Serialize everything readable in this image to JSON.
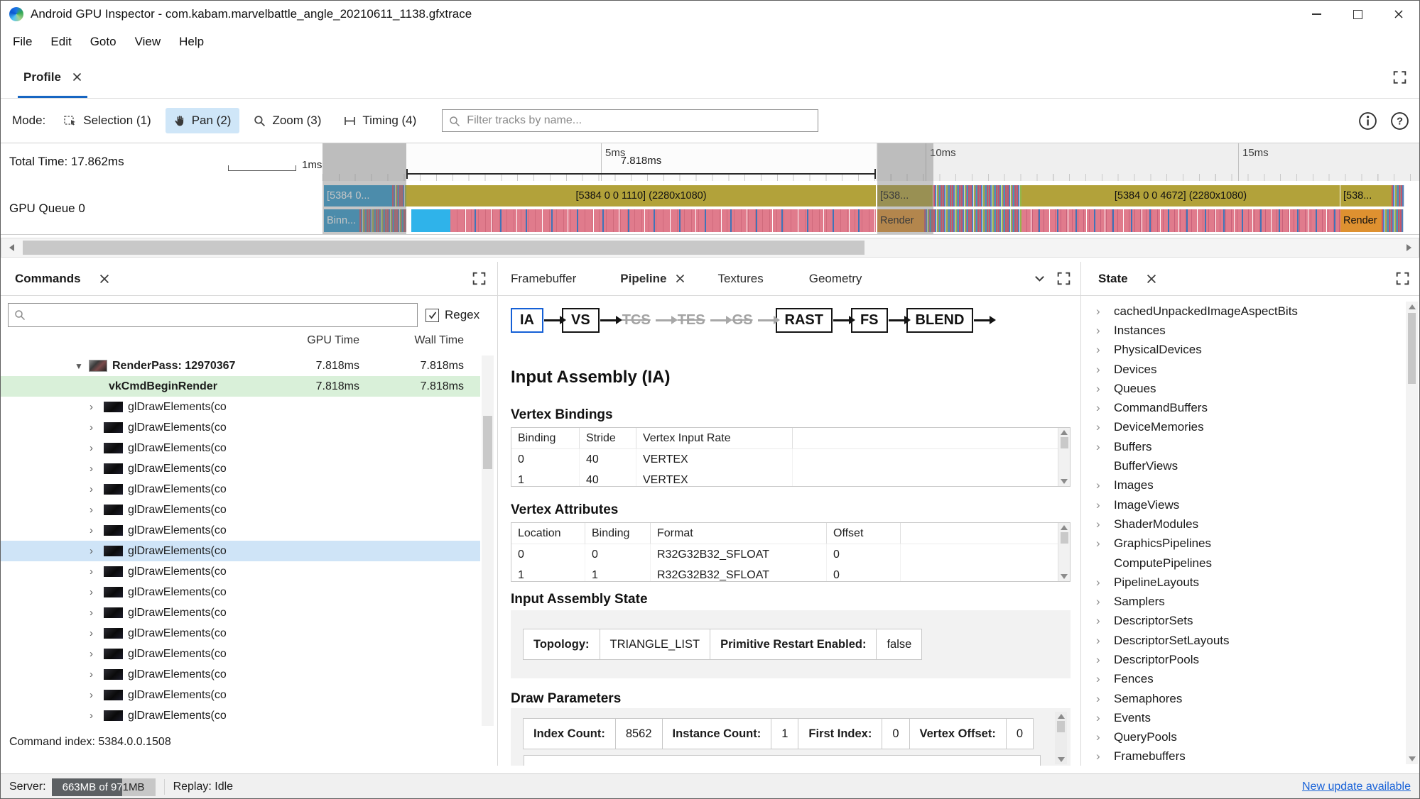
{
  "window": {
    "title": "Android GPU Inspector - com.kabam.marvelbattle_angle_20210611_1138.gfxtrace"
  },
  "menu": {
    "items": [
      {
        "label": "File"
      },
      {
        "label": "Edit"
      },
      {
        "label": "Goto"
      },
      {
        "label": "View"
      },
      {
        "label": "Help"
      }
    ]
  },
  "tabbar": {
    "profile_tab": "Profile"
  },
  "toolbar": {
    "mode_label": "Mode:",
    "buttons": [
      {
        "label": "Selection (1)",
        "icon": "selection-icon",
        "active": false
      },
      {
        "label": "Pan (2)",
        "icon": "pan-icon",
        "active": true
      },
      {
        "label": "Zoom (3)",
        "icon": "zoom-icon",
        "active": false
      },
      {
        "label": "Timing (4)",
        "icon": "timing-icon",
        "active": false
      }
    ],
    "filter_placeholder": "Filter tracks by name..."
  },
  "timeline": {
    "total_time_label": "Total Time: 17.862ms",
    "scale_label": "1ms",
    "ticks": [
      {
        "label": "5ms"
      },
      {
        "label": "10ms"
      },
      {
        "label": "15ms"
      }
    ],
    "selection_label": "7.818ms",
    "queue_label": "GPU Queue 0",
    "slices": {
      "binning_top": "[5384 0...",
      "binning_bottom": "Binn...",
      "pass1": "[5384 0 0 1110] (2280x1080)",
      "render1_top": "[538...",
      "render1_bottom": "Render",
      "pass2": "[5384 0 0 4672] (2280x1080)",
      "render2_top": "[538...",
      "render2_bottom": "Render"
    }
  },
  "commands": {
    "title": "Commands",
    "regex_label": "Regex",
    "col_gpu": "GPU Time",
    "col_wall": "Wall Time",
    "rows": [
      {
        "kind": "renderpass",
        "label": "RenderPass: 12970367",
        "gpu": "7.818ms",
        "wall": "7.818ms"
      },
      {
        "kind": "begin",
        "label": "vkCmdBeginRender",
        "gpu": "7.818ms",
        "wall": "7.818ms"
      },
      {
        "kind": "draw",
        "label": "glDrawElements(co",
        "gpu": "",
        "wall": ""
      },
      {
        "kind": "draw",
        "label": "glDrawElements(co",
        "gpu": "",
        "wall": ""
      },
      {
        "kind": "draw",
        "label": "glDrawElements(co",
        "gpu": "",
        "wall": ""
      },
      {
        "kind": "draw",
        "label": "glDrawElements(co",
        "gpu": "",
        "wall": ""
      },
      {
        "kind": "draw",
        "label": "glDrawElements(co",
        "gpu": "",
        "wall": ""
      },
      {
        "kind": "draw",
        "label": "glDrawElements(co",
        "gpu": "",
        "wall": ""
      },
      {
        "kind": "draw",
        "label": "glDrawElements(co",
        "gpu": "",
        "wall": ""
      },
      {
        "kind": "drawsel",
        "label": "glDrawElements(co",
        "gpu": "",
        "wall": ""
      },
      {
        "kind": "draw",
        "label": "glDrawElements(co",
        "gpu": "",
        "wall": ""
      },
      {
        "kind": "draw",
        "label": "glDrawElements(co",
        "gpu": "",
        "wall": ""
      },
      {
        "kind": "draw",
        "label": "glDrawElements(co",
        "gpu": "",
        "wall": ""
      },
      {
        "kind": "draw",
        "label": "glDrawElements(co",
        "gpu": "",
        "wall": ""
      },
      {
        "kind": "draw",
        "label": "glDrawElements(co",
        "gpu": "",
        "wall": ""
      },
      {
        "kind": "draw",
        "label": "glDrawElements(co",
        "gpu": "",
        "wall": ""
      },
      {
        "kind": "draw",
        "label": "glDrawElements(co",
        "gpu": "",
        "wall": ""
      },
      {
        "kind": "draw",
        "label": "glDrawElements(co",
        "gpu": "",
        "wall": ""
      }
    ],
    "footer": "Command index: 5384.0.0.1508"
  },
  "pipeline": {
    "tabs": [
      {
        "label": "Framebuffer",
        "active": false
      },
      {
        "label": "Pipeline",
        "active": true
      },
      {
        "label": "Textures",
        "active": false
      },
      {
        "label": "Geometry",
        "active": false
      }
    ],
    "stages": [
      {
        "label": "IA",
        "state": "selected"
      },
      {
        "label": "VS",
        "state": "normal"
      },
      {
        "label": "TCS",
        "state": "disabled"
      },
      {
        "label": "TES",
        "state": "disabled"
      },
      {
        "label": "GS",
        "state": "disabled"
      },
      {
        "label": "RAST",
        "state": "normal"
      },
      {
        "label": "FS",
        "state": "normal"
      },
      {
        "label": "BLEND",
        "state": "normal"
      }
    ],
    "heading": "Input Assembly (IA)",
    "bindings": {
      "title": "Vertex Bindings",
      "columns": [
        {
          "label": "Binding"
        },
        {
          "label": "Stride"
        },
        {
          "label": "Vertex Input Rate"
        }
      ],
      "rows": [
        {
          "c0": "0",
          "c1": "40",
          "c2": "VERTEX"
        },
        {
          "c0": "1",
          "c1": "40",
          "c2": "VERTEX"
        }
      ]
    },
    "attributes": {
      "title": "Vertex Attributes",
      "columns": [
        {
          "label": "Location"
        },
        {
          "label": "Binding"
        },
        {
          "label": "Format"
        },
        {
          "label": "Offset"
        }
      ],
      "rows": [
        {
          "c0": "0",
          "c1": "0",
          "c2": "R32G32B32_SFLOAT",
          "c3": "0"
        },
        {
          "c0": "1",
          "c1": "1",
          "c2": "R32G32B32_SFLOAT",
          "c3": "0"
        }
      ]
    },
    "ia_state": {
      "title": "Input Assembly State",
      "fields": [
        {
          "label": "Topology:",
          "value": "TRIANGLE_LIST"
        },
        {
          "label": "Primitive Restart Enabled:",
          "value": "false"
        }
      ]
    },
    "draw_params": {
      "title": "Draw Parameters",
      "fields": [
        {
          "label": "Index Count:",
          "value": "8562"
        },
        {
          "label": "Instance Count:",
          "value": "1"
        },
        {
          "label": "First Index:",
          "value": "0"
        },
        {
          "label": "Vertex Offset:",
          "value": "0"
        }
      ]
    }
  },
  "state_panel": {
    "title": "State",
    "items": [
      {
        "label": "cachedUnpackedImageAspectBits",
        "expandable": true
      },
      {
        "label": "Instances",
        "expandable": true
      },
      {
        "label": "PhysicalDevices",
        "expandable": true
      },
      {
        "label": "Devices",
        "expandable": true
      },
      {
        "label": "Queues",
        "expandable": true
      },
      {
        "label": "CommandBuffers",
        "expandable": true
      },
      {
        "label": "DeviceMemories",
        "expandable": true
      },
      {
        "label": "Buffers",
        "expandable": true
      },
      {
        "label": "BufferViews",
        "expandable": false
      },
      {
        "label": "Images",
        "expandable": true
      },
      {
        "label": "ImageViews",
        "expandable": true
      },
      {
        "label": "ShaderModules",
        "expandable": true
      },
      {
        "label": "GraphicsPipelines",
        "expandable": true
      },
      {
        "label": "ComputePipelines",
        "expandable": false
      },
      {
        "label": "PipelineLayouts",
        "expandable": true
      },
      {
        "label": "Samplers",
        "expandable": true
      },
      {
        "label": "DescriptorSets",
        "expandable": true
      },
      {
        "label": "DescriptorSetLayouts",
        "expandable": true
      },
      {
        "label": "DescriptorPools",
        "expandable": true
      },
      {
        "label": "Fences",
        "expandable": true
      },
      {
        "label": "Semaphores",
        "expandable": true
      },
      {
        "label": "Events",
        "expandable": true
      },
      {
        "label": "QueryPools",
        "expandable": true
      },
      {
        "label": "Framebuffers",
        "expandable": true
      }
    ]
  },
  "statusbar": {
    "server_label": "Server:",
    "memory": "663MB of 971MB",
    "replay": "Replay: Idle",
    "update_link": "New update available"
  }
}
